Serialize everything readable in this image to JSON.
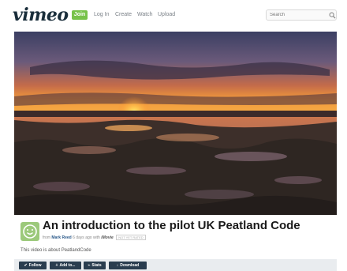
{
  "header": {
    "logo": "vimeo",
    "join_label": "Join",
    "nav": [
      "Log In",
      "Create",
      "Watch",
      "Upload"
    ],
    "search_placeholder": "Search"
  },
  "video": {
    "title": "An introduction to the pilot UK Peatland Code",
    "byline_from": "from",
    "author": "Mark Reed",
    "byline_time": "6 days ago",
    "byline_with": "with",
    "app": "iMovie",
    "badge": "NOT YET RATED",
    "description": "This video is about PeatlandCode"
  },
  "actions": [
    {
      "icon": "check-icon",
      "glyph": "✔",
      "label": "Follow"
    },
    {
      "icon": "plus-icon",
      "glyph": "+",
      "label": "Add to..."
    },
    {
      "icon": "stats-icon",
      "glyph": "⌁",
      "label": "Stats"
    },
    {
      "icon": "download-icon",
      "glyph": "↓",
      "label": "Download"
    }
  ],
  "colors": {
    "join": "#77c24a",
    "button_bg": "#2a3d4f",
    "action_bar": "#e9ecef",
    "avatar": "#9cc97b"
  }
}
